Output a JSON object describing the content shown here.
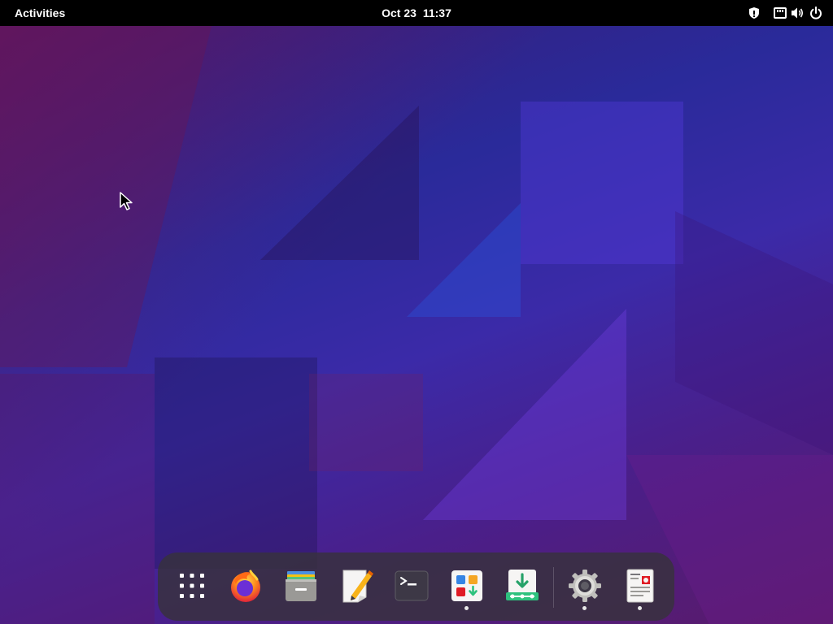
{
  "topbar": {
    "activities_label": "Activities",
    "clock_date": "Oct 23",
    "clock_time": "11:37",
    "tray_icons": [
      "privacy-shield-icon",
      "network-wired-icon",
      "volume-icon",
      "power-icon"
    ]
  },
  "dock": {
    "items": [
      {
        "name": "app-grid",
        "running": false
      },
      {
        "name": "firefox",
        "running": false
      },
      {
        "name": "files",
        "running": false
      },
      {
        "name": "text-editor",
        "running": false
      },
      {
        "name": "terminal",
        "running": false
      },
      {
        "name": "software",
        "running": true
      },
      {
        "name": "installer",
        "running": false
      },
      {
        "name": "settings",
        "running": true
      },
      {
        "name": "document-viewer",
        "running": true
      }
    ]
  },
  "colors": {
    "topbar_bg": "#000000",
    "dock_bg": "#37323c",
    "wallpaper_primary": "#2a2a9a",
    "wallpaper_secondary": "#5a1a6a"
  }
}
